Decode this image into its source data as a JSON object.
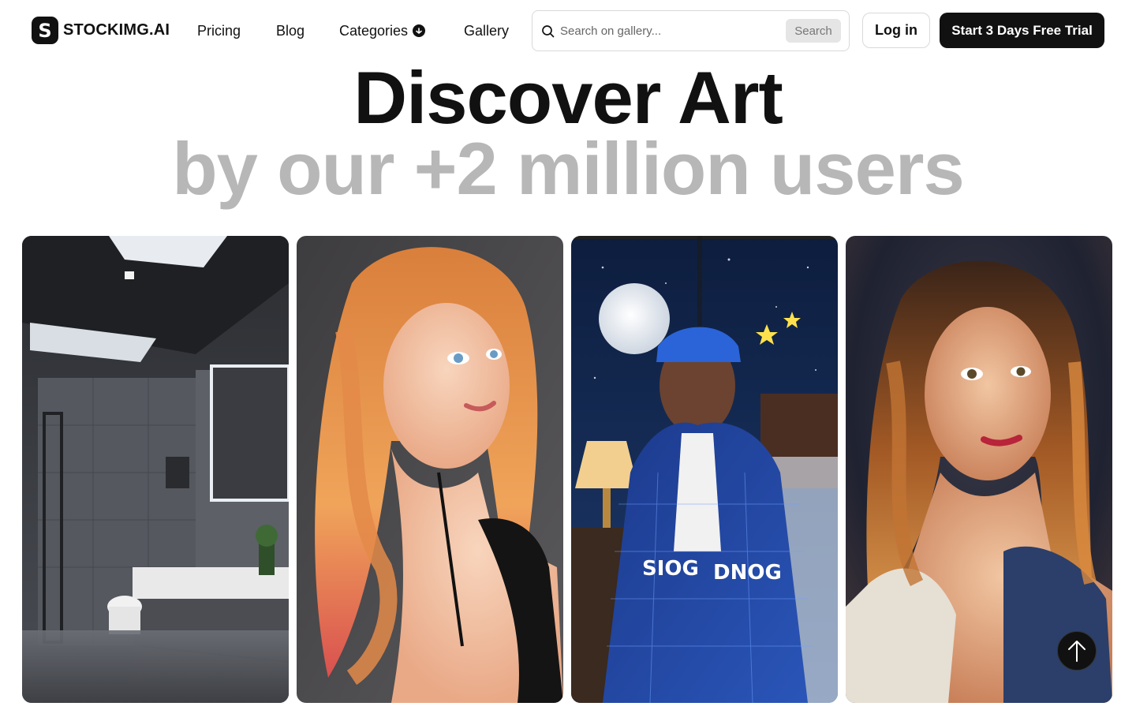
{
  "brand": {
    "name": "STOCKIMG.AI",
    "mark": "S"
  },
  "nav": {
    "pricing": "Pricing",
    "blog": "Blog",
    "categories": "Categories",
    "gallery": "Gallery"
  },
  "search": {
    "placeholder": "Search on gallery...",
    "button": "Search"
  },
  "auth": {
    "login": "Log in",
    "trial": "Start 3 Days Free Trial"
  },
  "hero": {
    "title": "Discover Art",
    "subtitle": "by our +2 million users"
  },
  "gallery": {
    "images": [
      {
        "icon": "bathroom-image"
      },
      {
        "icon": "portrait-redhead-image"
      },
      {
        "icon": "night-portrait-image"
      },
      {
        "icon": "watercolor-portrait-image"
      }
    ]
  },
  "colors": {
    "primary": "#111111",
    "muted": "#b7b7b7",
    "border": "#d9d9d9"
  }
}
